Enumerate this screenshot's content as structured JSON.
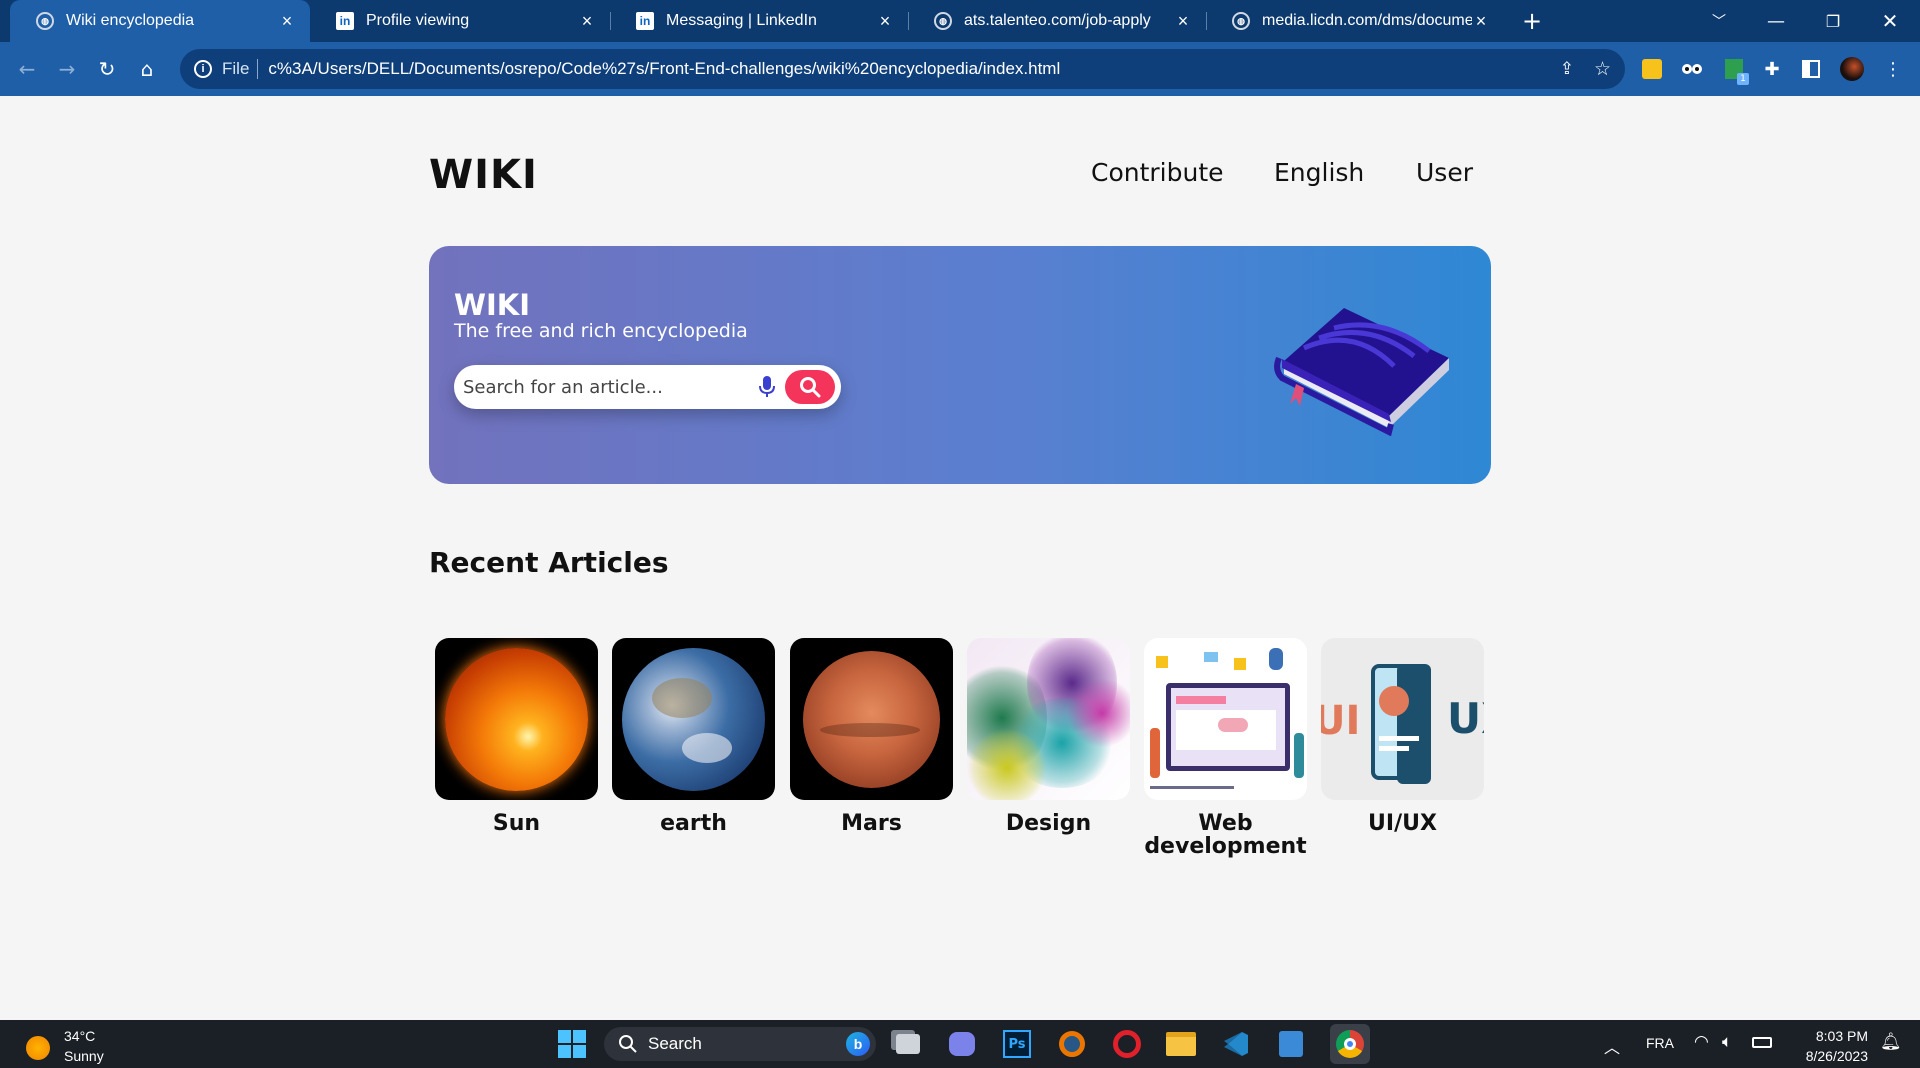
{
  "browser": {
    "tabs": [
      {
        "title": "Wiki encyclopedia",
        "icon": "globe-icon",
        "active": true
      },
      {
        "title": "Profile viewing",
        "icon": "linkedin-icon",
        "active": false
      },
      {
        "title": "Messaging | LinkedIn",
        "icon": "linkedin-icon",
        "active": false
      },
      {
        "title": "ats.talenteo.com/job-apply",
        "icon": "globe-icon",
        "active": false
      },
      {
        "title": "media.licdn.com/dms/document/",
        "icon": "globe-icon",
        "active": false
      }
    ],
    "tab_close": "×",
    "new_tab": "+",
    "address": {
      "scheme_label": "File",
      "url": "c%3A/Users/DELL/Documents/osrepo/Code%27s/Front-End-challenges/wiki%20encyclopedia/index.html"
    }
  },
  "site": {
    "logo": "WIKI",
    "nav": [
      "Contribute",
      "English",
      "User"
    ],
    "hero": {
      "title": "WIKI",
      "subtitle": "The free and rich encyclopedia",
      "search_placeholder": "Search for an article..."
    },
    "recent_title": "Recent Articles",
    "articles": [
      {
        "label": "Sun",
        "image": "sun"
      },
      {
        "label": "earth",
        "image": "earth"
      },
      {
        "label": "Mars",
        "image": "mars"
      },
      {
        "label": "Design",
        "image": "ink-smoke"
      },
      {
        "label": "Web development",
        "image": "web-dev-illustration"
      },
      {
        "label": "UI/UX",
        "image": "ui-ux-phone"
      }
    ]
  },
  "taskbar": {
    "weather": {
      "temp": "34°C",
      "condition": "Sunny"
    },
    "search_label": "Search",
    "language": "FRA",
    "time": "8:03 PM",
    "date": "8/26/2023"
  },
  "colors": {
    "tabbar": "#0d3a6e",
    "toolbar": "#1e5fa8",
    "hero_start": "#7272bd",
    "hero_end": "#2e88d4",
    "search_button": "#f4345b"
  }
}
